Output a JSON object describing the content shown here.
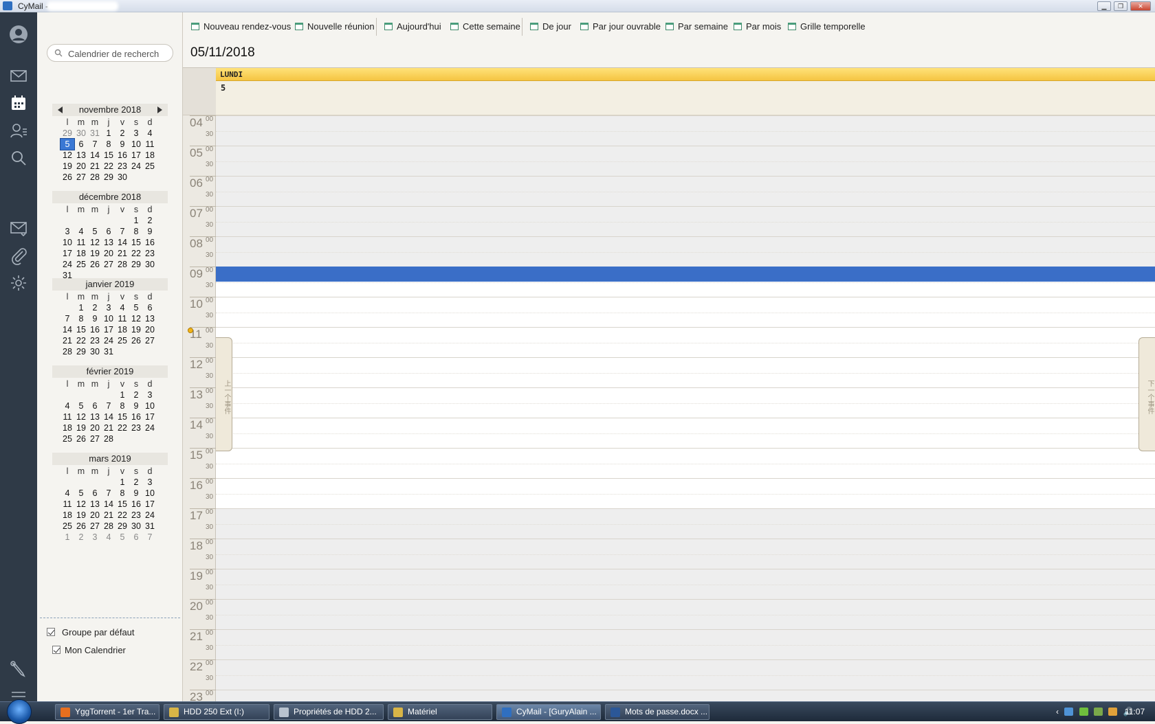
{
  "window": {
    "title": "CyMail -",
    "minimize": "▁",
    "restore": "❐",
    "close": "✕"
  },
  "rail": {
    "icons": [
      "avatar-icon",
      "mail-icon",
      "calendar-icon",
      "contacts-icon",
      "search-icon",
      "mail-filter-icon",
      "attachment-icon",
      "gear-icon",
      "wrench-icon",
      "menu-icon"
    ]
  },
  "search": {
    "placeholder": "Calendrier de recherch"
  },
  "toolbar": {
    "new_appointment": "Nouveau rendez-vous",
    "new_meeting": "Nouvelle réunion",
    "today": "Aujourd'hui",
    "this_week": "Cette semaine",
    "day": "De jour",
    "work_week": "Par jour ouvrable",
    "week": "Par semaine",
    "month": "Par mois",
    "timeline": "Grille temporelle"
  },
  "current_date": "05/11/2018",
  "day_header": {
    "weekday": "LUNDI",
    "day_number": "5"
  },
  "dow": [
    "l",
    "m",
    "m",
    "j",
    "v",
    "s",
    "d"
  ],
  "mini_calendars": [
    {
      "title": "novembre 2018",
      "nav": true,
      "days": [
        {
          "t": "29",
          "o": true
        },
        {
          "t": "30",
          "o": true
        },
        {
          "t": "31",
          "o": true
        },
        {
          "t": "1"
        },
        {
          "t": "2"
        },
        {
          "t": "3"
        },
        {
          "t": "4"
        },
        {
          "t": "5",
          "today": true
        },
        {
          "t": "6"
        },
        {
          "t": "7"
        },
        {
          "t": "8"
        },
        {
          "t": "9"
        },
        {
          "t": "10"
        },
        {
          "t": "11"
        },
        {
          "t": "12"
        },
        {
          "t": "13"
        },
        {
          "t": "14"
        },
        {
          "t": "15"
        },
        {
          "t": "16"
        },
        {
          "t": "17"
        },
        {
          "t": "18"
        },
        {
          "t": "19"
        },
        {
          "t": "20"
        },
        {
          "t": "21"
        },
        {
          "t": "22"
        },
        {
          "t": "23"
        },
        {
          "t": "24"
        },
        {
          "t": "25"
        },
        {
          "t": "26"
        },
        {
          "t": "27"
        },
        {
          "t": "28"
        },
        {
          "t": "29"
        },
        {
          "t": "30"
        }
      ]
    },
    {
      "title": "décembre 2018",
      "days": [
        {
          "t": ""
        },
        {
          "t": ""
        },
        {
          "t": ""
        },
        {
          "t": ""
        },
        {
          "t": ""
        },
        {
          "t": "1"
        },
        {
          "t": "2"
        },
        {
          "t": "3"
        },
        {
          "t": "4"
        },
        {
          "t": "5"
        },
        {
          "t": "6"
        },
        {
          "t": "7"
        },
        {
          "t": "8"
        },
        {
          "t": "9"
        },
        {
          "t": "10"
        },
        {
          "t": "11"
        },
        {
          "t": "12"
        },
        {
          "t": "13"
        },
        {
          "t": "14"
        },
        {
          "t": "15"
        },
        {
          "t": "16"
        },
        {
          "t": "17"
        },
        {
          "t": "18"
        },
        {
          "t": "19"
        },
        {
          "t": "20"
        },
        {
          "t": "21"
        },
        {
          "t": "22"
        },
        {
          "t": "23"
        },
        {
          "t": "24"
        },
        {
          "t": "25"
        },
        {
          "t": "26"
        },
        {
          "t": "27"
        },
        {
          "t": "28"
        },
        {
          "t": "29"
        },
        {
          "t": "30"
        },
        {
          "t": "31"
        }
      ]
    },
    {
      "title": "janvier 2019",
      "days": [
        {
          "t": ""
        },
        {
          "t": "1"
        },
        {
          "t": "2"
        },
        {
          "t": "3"
        },
        {
          "t": "4"
        },
        {
          "t": "5"
        },
        {
          "t": "6"
        },
        {
          "t": "7"
        },
        {
          "t": "8"
        },
        {
          "t": "9"
        },
        {
          "t": "10"
        },
        {
          "t": "11"
        },
        {
          "t": "12"
        },
        {
          "t": "13"
        },
        {
          "t": "14"
        },
        {
          "t": "15"
        },
        {
          "t": "16"
        },
        {
          "t": "17"
        },
        {
          "t": "18"
        },
        {
          "t": "19"
        },
        {
          "t": "20"
        },
        {
          "t": "21"
        },
        {
          "t": "22"
        },
        {
          "t": "23"
        },
        {
          "t": "24"
        },
        {
          "t": "25"
        },
        {
          "t": "26"
        },
        {
          "t": "27"
        },
        {
          "t": "28"
        },
        {
          "t": "29"
        },
        {
          "t": "30"
        },
        {
          "t": "31"
        }
      ]
    },
    {
      "title": "février 2019",
      "days": [
        {
          "t": ""
        },
        {
          "t": ""
        },
        {
          "t": ""
        },
        {
          "t": ""
        },
        {
          "t": "1"
        },
        {
          "t": "2"
        },
        {
          "t": "3"
        },
        {
          "t": "4"
        },
        {
          "t": "5"
        },
        {
          "t": "6"
        },
        {
          "t": "7"
        },
        {
          "t": "8"
        },
        {
          "t": "9"
        },
        {
          "t": "10"
        },
        {
          "t": "11"
        },
        {
          "t": "12"
        },
        {
          "t": "13"
        },
        {
          "t": "14"
        },
        {
          "t": "15"
        },
        {
          "t": "16"
        },
        {
          "t": "17"
        },
        {
          "t": "18"
        },
        {
          "t": "19"
        },
        {
          "t": "20"
        },
        {
          "t": "21"
        },
        {
          "t": "22"
        },
        {
          "t": "23"
        },
        {
          "t": "24"
        },
        {
          "t": "25"
        },
        {
          "t": "26"
        },
        {
          "t": "27"
        },
        {
          "t": "28"
        }
      ]
    },
    {
      "title": "mars 2019",
      "days": [
        {
          "t": ""
        },
        {
          "t": ""
        },
        {
          "t": ""
        },
        {
          "t": ""
        },
        {
          "t": "1"
        },
        {
          "t": "2"
        },
        {
          "t": "3"
        },
        {
          "t": "4"
        },
        {
          "t": "5"
        },
        {
          "t": "6"
        },
        {
          "t": "7"
        },
        {
          "t": "8"
        },
        {
          "t": "9"
        },
        {
          "t": "10"
        },
        {
          "t": "11"
        },
        {
          "t": "12"
        },
        {
          "t": "13"
        },
        {
          "t": "14"
        },
        {
          "t": "15"
        },
        {
          "t": "16"
        },
        {
          "t": "17"
        },
        {
          "t": "18"
        },
        {
          "t": "19"
        },
        {
          "t": "20"
        },
        {
          "t": "21"
        },
        {
          "t": "22"
        },
        {
          "t": "23"
        },
        {
          "t": "24"
        },
        {
          "t": "25"
        },
        {
          "t": "26"
        },
        {
          "t": "27"
        },
        {
          "t": "28"
        },
        {
          "t": "29"
        },
        {
          "t": "30"
        },
        {
          "t": "31"
        },
        {
          "t": "1",
          "o": true
        },
        {
          "t": "2",
          "o": true
        },
        {
          "t": "3",
          "o": true
        },
        {
          "t": "4",
          "o": true
        },
        {
          "t": "5",
          "o": true
        },
        {
          "t": "6",
          "o": true
        },
        {
          "t": "7",
          "o": true
        }
      ]
    }
  ],
  "calendars": {
    "group": "Groupe par défaut",
    "mine": "Mon Calendrier"
  },
  "hours": [
    {
      "h": "04",
      "work": false
    },
    {
      "h": "05",
      "work": false
    },
    {
      "h": "06",
      "work": false
    },
    {
      "h": "07",
      "work": false
    },
    {
      "h": "08",
      "work": false
    },
    {
      "h": "09",
      "work": true
    },
    {
      "h": "10",
      "work": true
    },
    {
      "h": "11",
      "work": true
    },
    {
      "h": "12",
      "work": true
    },
    {
      "h": "13",
      "work": true
    },
    {
      "h": "14",
      "work": true
    },
    {
      "h": "15",
      "work": true
    },
    {
      "h": "16",
      "work": true
    },
    {
      "h": "17",
      "work": false
    },
    {
      "h": "18",
      "work": false
    },
    {
      "h": "19",
      "work": false
    },
    {
      "h": "20",
      "work": false
    },
    {
      "h": "21",
      "work": false
    },
    {
      "h": "22",
      "work": false
    },
    {
      "h": "23",
      "work": false
    }
  ],
  "minute_labels": {
    "top": "00",
    "half": "30"
  },
  "edge_tabs": {
    "prev": "上一个事件",
    "next": "下一个事件"
  },
  "taskbar": {
    "items": [
      {
        "label": "YggTorrent - 1er Tra...",
        "icon_color": "#e76f1f"
      },
      {
        "label": "HDD 250 Ext  (I:)",
        "icon_color": "#d8b547"
      },
      {
        "label": "Propriétés de HDD 2...",
        "icon_color": "#b9c3cf"
      },
      {
        "label": "Matériel",
        "icon_color": "#d8b547"
      },
      {
        "label": "CyMail - [GuryAlain ...",
        "icon_color": "#2f6fc0",
        "active": true
      },
      {
        "label": "Mots de passe.docx ...",
        "icon_color": "#2b5797"
      }
    ],
    "time": "11:07"
  },
  "colors": {
    "rail": "#2f3a47",
    "selection": "#3a6ec7",
    "day_header": "#f5c542",
    "mini_today": "#3a78d4"
  }
}
